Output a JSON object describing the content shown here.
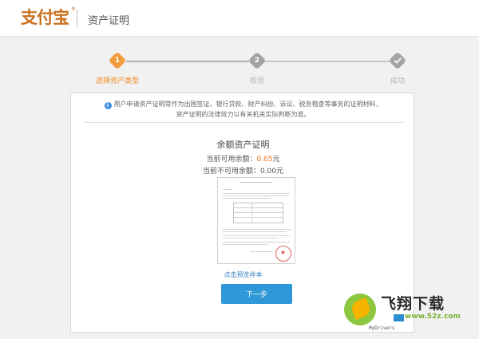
{
  "header": {
    "logo_text": "支付宝",
    "logo_reg": "®",
    "title": "资产证明"
  },
  "steps": [
    {
      "number": "1",
      "label": "选择资产类型",
      "state": "active"
    },
    {
      "number": "2",
      "label": "校验",
      "state": "pending"
    },
    {
      "number": "",
      "label": "成功",
      "state": "pending",
      "icon": "check-icon"
    }
  ],
  "notice": {
    "line1": "用户申请资产证明常作为出国签证、银行贷款、财产纠纷、诉讼、税务稽查等事务的证明材料，",
    "line2": "资产证明的法律效力以有关机关实际判断为准。"
  },
  "certificate": {
    "title": "余额资产证明",
    "available_label": "当前可用余额：",
    "available_value": "0.65",
    "available_unit": "元",
    "unavailable_label": "当前不可用余额：",
    "unavailable_value": "0.00",
    "unavailable_unit": "元"
  },
  "sample": {
    "preview_link": "点击预览样本"
  },
  "actions": {
    "next_label": "下一步"
  },
  "watermark": {
    "brand": "飞翔下载",
    "url": "www.52z.com",
    "small": "MyDrivers"
  },
  "colors": {
    "accent": "#f29c3d",
    "primary_button": "#2e98d8",
    "link": "#3a7fc4",
    "amount": "#f27321"
  }
}
